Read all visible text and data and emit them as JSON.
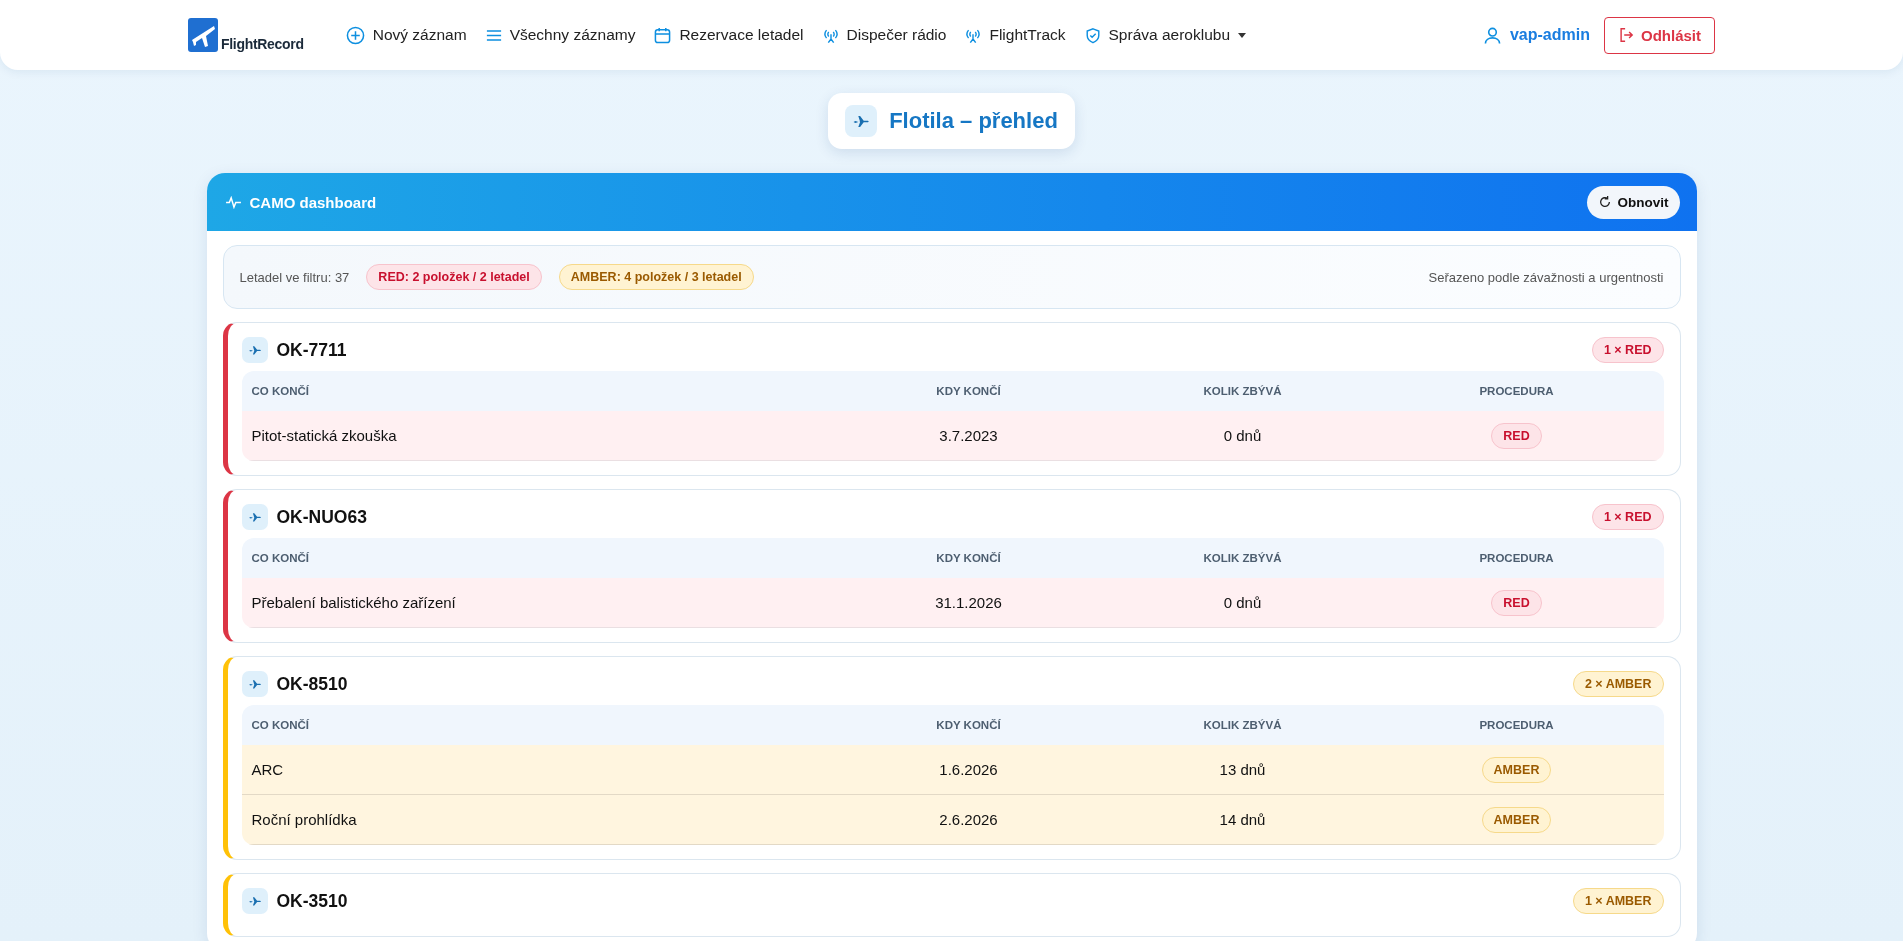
{
  "navbar": {
    "brand": "FlightRecord",
    "items": [
      {
        "label": "Nový záznam"
      },
      {
        "label": "Všechny záznamy"
      },
      {
        "label": "Rezervace letadel"
      },
      {
        "label": "Dispečer rádio"
      },
      {
        "label": "FlightTrack"
      },
      {
        "label": "Správa aeroklubu",
        "dropdown": true
      }
    ],
    "user": "vap-admin",
    "logout": "Odhlásit"
  },
  "page_title": "Flotila – přehled",
  "dashboard": {
    "title": "CAMO dashboard",
    "refresh": "Obnovit",
    "summary": {
      "count": "Letadel ve filtru: 37",
      "badges": [
        {
          "kind": "red",
          "text": "RED: 2 položek / 2 letadel"
        },
        {
          "kind": "amber",
          "text": "AMBER: 4 položek / 3 letadel"
        }
      ],
      "sort_note": "Seřazeno podle závažnosti a urgentnosti"
    },
    "aircraft": [
      {
        "registration": "OK-7711",
        "kind": "red",
        "badge": "1 × RED",
        "columns": [
          "CO KONČÍ",
          "KDY KONČÍ",
          "KOLIK ZBÝVÁ",
          "PROCEDURA"
        ],
        "rows": [
          {
            "item": "Pitot-statická zkouška",
            "date": "3.7.2023",
            "remaining": "0 dnů",
            "procedure": "RED",
            "kind": "red"
          }
        ]
      },
      {
        "registration": "OK-NUO63",
        "kind": "red",
        "badge": "1 × RED",
        "columns": [
          "CO KONČÍ",
          "KDY KONČÍ",
          "KOLIK ZBÝVÁ",
          "PROCEDURA"
        ],
        "rows": [
          {
            "item": "Přebalení balistického zařízení",
            "date": "31.1.2026",
            "remaining": "0 dnů",
            "procedure": "RED",
            "kind": "red"
          }
        ]
      },
      {
        "registration": "OK-8510",
        "kind": "amber",
        "badge": "2 × AMBER",
        "columns": [
          "CO KONČÍ",
          "KDY KONČÍ",
          "KOLIK ZBÝVÁ",
          "PROCEDURA"
        ],
        "rows": [
          {
            "item": "ARC",
            "date": "1.6.2026",
            "remaining": "13 dnů",
            "procedure": "AMBER",
            "kind": "amber"
          },
          {
            "item": "Roční prohlídka",
            "date": "2.6.2026",
            "remaining": "14 dnů",
            "procedure": "AMBER",
            "kind": "amber"
          }
        ]
      },
      {
        "registration": "OK-3510",
        "kind": "amber",
        "badge": "1 × AMBER"
      }
    ]
  }
}
